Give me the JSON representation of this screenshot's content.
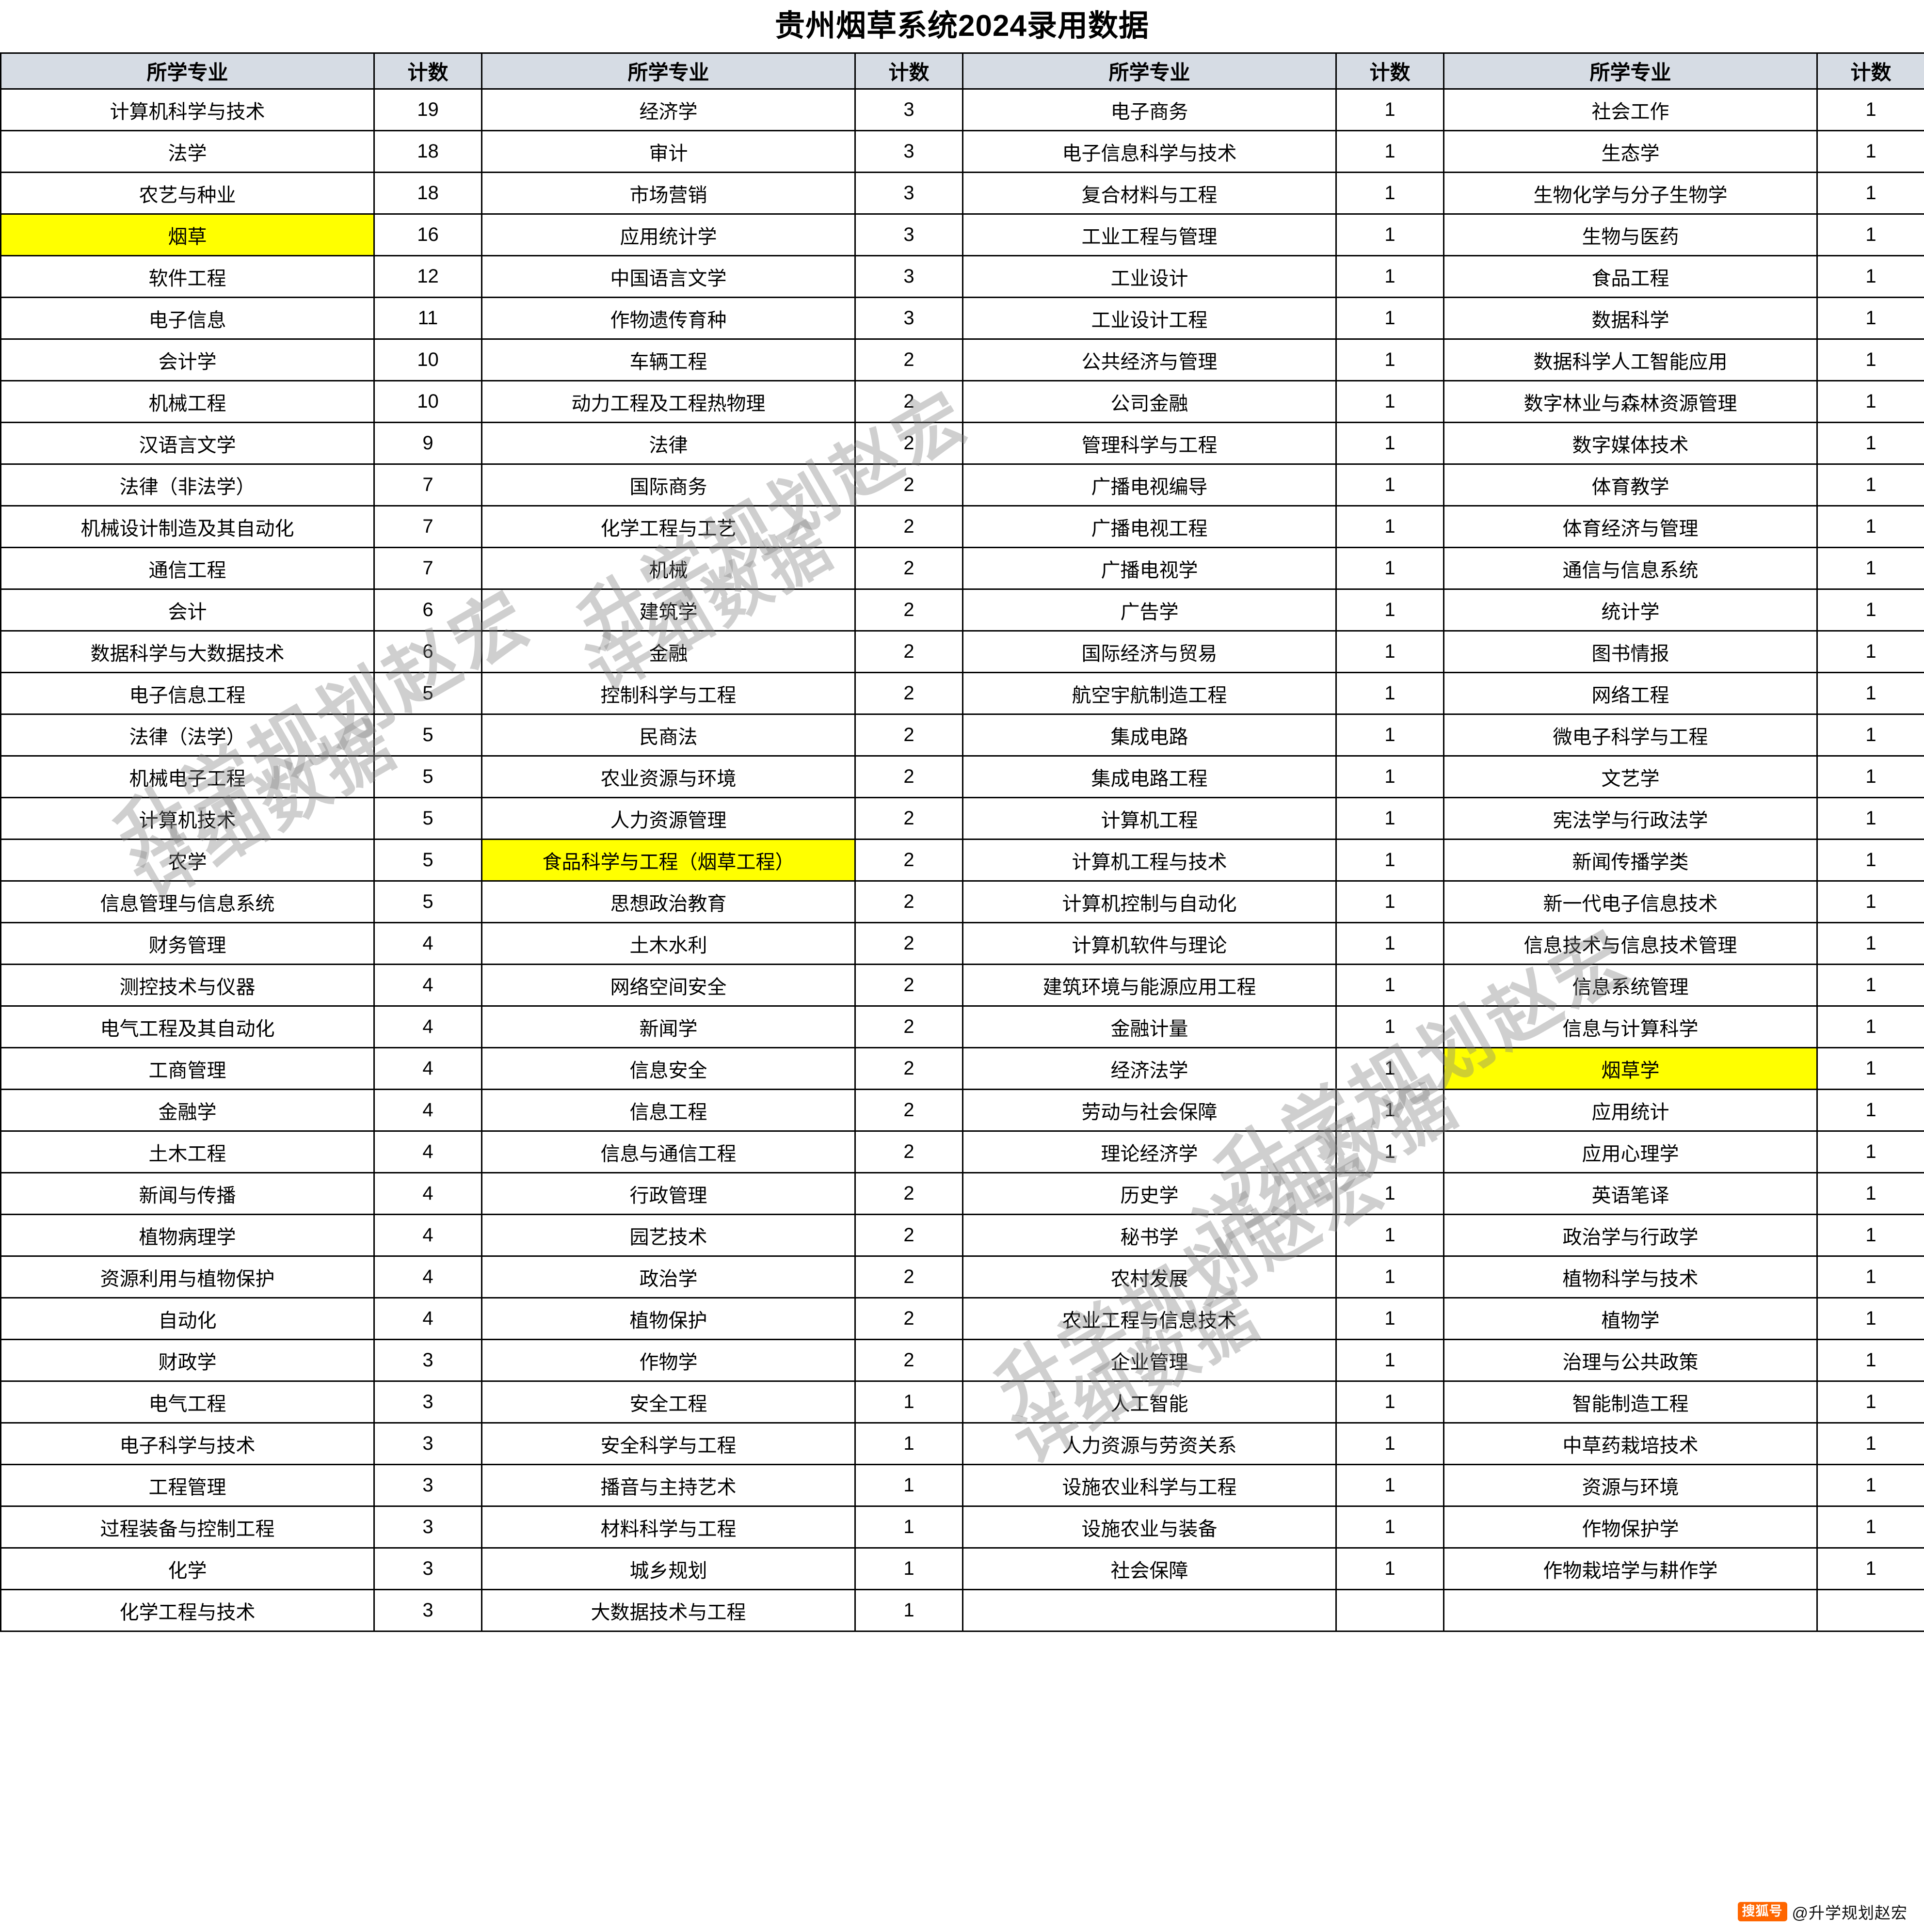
{
  "page": {
    "title": "贵州烟草系统2024录用数据",
    "highlight_color": "#ffff00",
    "header_bg": "#d6dce4"
  },
  "headers": {
    "major": "所学专业",
    "count": "计数"
  },
  "watermark": {
    "line1": "升学规划赵宏",
    "line2": "详细数据"
  },
  "footer": {
    "badge": "搜狐号",
    "text": "@升学规划赵宏"
  },
  "chart_data": {
    "type": "table",
    "title": "贵州烟草系统2024录用数据",
    "columns": [
      "所学专业",
      "计数",
      "所学专业",
      "计数",
      "所学专业",
      "计数",
      "所学专业",
      "计数"
    ],
    "rows": [
      [
        "计算机科学与技术",
        "19",
        "经济学",
        "3",
        "电子商务",
        "1",
        "社会工作",
        "1"
      ],
      [
        "法学",
        "18",
        "审计",
        "3",
        "电子信息科学与技术",
        "1",
        "生态学",
        "1"
      ],
      [
        "农艺与种业",
        "18",
        "市场营销",
        "3",
        "复合材料与工程",
        "1",
        "生物化学与分子生物学",
        "1"
      ],
      [
        "烟草",
        "16",
        "应用统计学",
        "3",
        "工业工程与管理",
        "1",
        "生物与医药",
        "1"
      ],
      [
        "软件工程",
        "12",
        "中国语言文学",
        "3",
        "工业设计",
        "1",
        "食品工程",
        "1"
      ],
      [
        "电子信息",
        "11",
        "作物遗传育种",
        "3",
        "工业设计工程",
        "1",
        "数据科学",
        "1"
      ],
      [
        "会计学",
        "10",
        "车辆工程",
        "2",
        "公共经济与管理",
        "1",
        "数据科学人工智能应用",
        "1"
      ],
      [
        "机械工程",
        "10",
        "动力工程及工程热物理",
        "2",
        "公司金融",
        "1",
        "数字林业与森林资源管理",
        "1"
      ],
      [
        "汉语言文学",
        "9",
        "法律",
        "2",
        "管理科学与工程",
        "1",
        "数字媒体技术",
        "1"
      ],
      [
        "法律（非法学）",
        "7",
        "国际商务",
        "2",
        "广播电视编导",
        "1",
        "体育教学",
        "1"
      ],
      [
        "机械设计制造及其自动化",
        "7",
        "化学工程与工艺",
        "2",
        "广播电视工程",
        "1",
        "体育经济与管理",
        "1"
      ],
      [
        "通信工程",
        "7",
        "机械",
        "2",
        "广播电视学",
        "1",
        "通信与信息系统",
        "1"
      ],
      [
        "会计",
        "6",
        "建筑学",
        "2",
        "广告学",
        "1",
        "统计学",
        "1"
      ],
      [
        "数据科学与大数据技术",
        "6",
        "金融",
        "2",
        "国际经济与贸易",
        "1",
        "图书情报",
        "1"
      ],
      [
        "电子信息工程",
        "5",
        "控制科学与工程",
        "2",
        "航空宇航制造工程",
        "1",
        "网络工程",
        "1"
      ],
      [
        "法律（法学）",
        "5",
        "民商法",
        "2",
        "集成电路",
        "1",
        "微电子科学与工程",
        "1"
      ],
      [
        "机械电子工程",
        "5",
        "农业资源与环境",
        "2",
        "集成电路工程",
        "1",
        "文艺学",
        "1"
      ],
      [
        "计算机技术",
        "5",
        "人力资源管理",
        "2",
        "计算机工程",
        "1",
        "宪法学与行政法学",
        "1"
      ],
      [
        "农学",
        "5",
        "食品科学与工程（烟草工程）",
        "2",
        "计算机工程与技术",
        "1",
        "新闻传播学类",
        "1"
      ],
      [
        "信息管理与信息系统",
        "5",
        "思想政治教育",
        "2",
        "计算机控制与自动化",
        "1",
        "新一代电子信息技术",
        "1"
      ],
      [
        "财务管理",
        "4",
        "土木水利",
        "2",
        "计算机软件与理论",
        "1",
        "信息技术与信息技术管理",
        "1"
      ],
      [
        "测控技术与仪器",
        "4",
        "网络空间安全",
        "2",
        "建筑环境与能源应用工程",
        "1",
        "信息系统管理",
        "1"
      ],
      [
        "电气工程及其自动化",
        "4",
        "新闻学",
        "2",
        "金融计量",
        "1",
        "信息与计算科学",
        "1"
      ],
      [
        "工商管理",
        "4",
        "信息安全",
        "2",
        "经济法学",
        "1",
        "烟草学",
        "1"
      ],
      [
        "金融学",
        "4",
        "信息工程",
        "2",
        "劳动与社会保障",
        "1",
        "应用统计",
        "1"
      ],
      [
        "土木工程",
        "4",
        "信息与通信工程",
        "2",
        "理论经济学",
        "1",
        "应用心理学",
        "1"
      ],
      [
        "新闻与传播",
        "4",
        "行政管理",
        "2",
        "历史学",
        "1",
        "英语笔译",
        "1"
      ],
      [
        "植物病理学",
        "4",
        "园艺技术",
        "2",
        "秘书学",
        "1",
        "政治学与行政学",
        "1"
      ],
      [
        "资源利用与植物保护",
        "4",
        "政治学",
        "2",
        "农村发展",
        "1",
        "植物科学与技术",
        "1"
      ],
      [
        "自动化",
        "4",
        "植物保护",
        "2",
        "农业工程与信息技术",
        "1",
        "植物学",
        "1"
      ],
      [
        "财政学",
        "3",
        "作物学",
        "2",
        "企业管理",
        "1",
        "治理与公共政策",
        "1"
      ],
      [
        "电气工程",
        "3",
        "安全工程",
        "1",
        "人工智能",
        "1",
        "智能制造工程",
        "1"
      ],
      [
        "电子科学与技术",
        "3",
        "安全科学与工程",
        "1",
        "人力资源与劳资关系",
        "1",
        "中草药栽培技术",
        "1"
      ],
      [
        "工程管理",
        "3",
        "播音与主持艺术",
        "1",
        "设施农业科学与工程",
        "1",
        "资源与环境",
        "1"
      ],
      [
        "过程装备与控制工程",
        "3",
        "材料科学与工程",
        "1",
        "设施农业与装备",
        "1",
        "作物保护学",
        "1"
      ],
      [
        "化学",
        "3",
        "城乡规划",
        "1",
        "社会保障",
        "1",
        "作物栽培学与耕作学",
        "1"
      ],
      [
        "化学工程与技术",
        "3",
        "大数据技术与工程",
        "1",
        "",
        "",
        "",
        ""
      ]
    ],
    "highlighted_cells": [
      {
        "row": 3,
        "col": 0,
        "label": "烟草"
      },
      {
        "row": 18,
        "col": 2,
        "label": "食品科学与工程（烟草工程）"
      },
      {
        "row": 23,
        "col": 6,
        "label": "烟草学"
      }
    ]
  }
}
